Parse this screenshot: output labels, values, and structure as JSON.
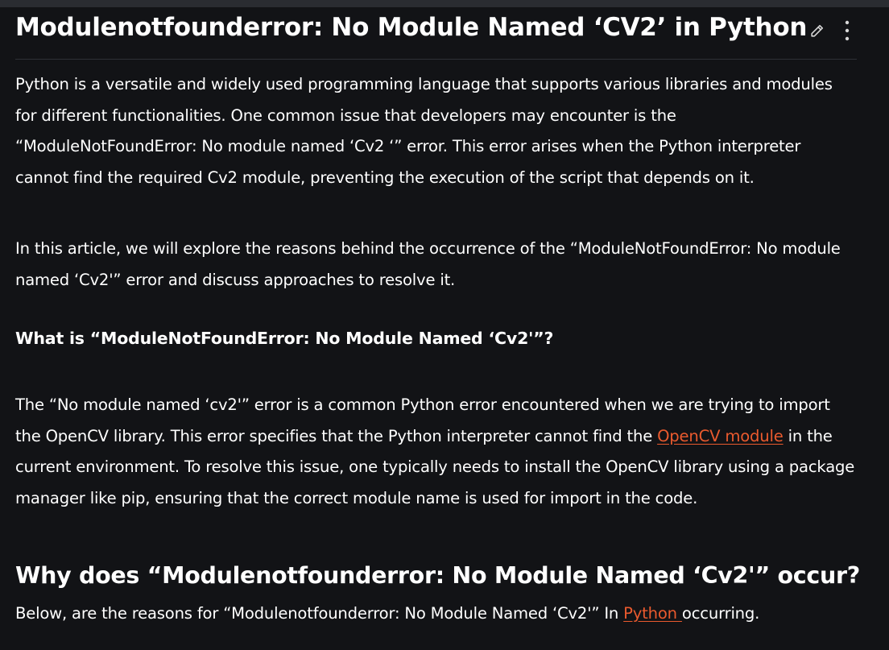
{
  "article": {
    "title": "Modulenotfounderror: No Module Named ‘CV2’ in Python",
    "actions": {
      "edit_icon": "pencil-icon",
      "more_icon": "more-vertical-icon"
    },
    "p1": "Python is a versatile and widely used programming language that supports various libraries and modules for different functionalities. One common issue that developers may encounter is the “ModuleNotFoundError: No module named ‘Cv2 ‘” error. This error arises when the Python interpreter cannot find the required Cv2 module, preventing the execution of the script that depends on it.",
    "p2": "In this article, we will explore the reasons behind the occurrence of the “ModuleNotFoundError: No module named ‘Cv2'” error and discuss approaches to resolve it.",
    "h3": "What is “ModuleNotFoundError: No Module Named ‘Cv2'”?",
    "p3": {
      "before": "The “No module named ‘cv2'” error is a common Python error encountered when we are trying to import the OpenCV library. This error specifies that the Python interpreter cannot find the ",
      "link": "OpenCV module",
      "after": " in the current environment. To resolve this issue, one typically needs to install the OpenCV library using a package manager like pip, ensuring that the correct module name is used for import in the code."
    },
    "h2": "Why does “Modulenotfounderror: No Module Named ‘Cv2'” occur?",
    "p4": {
      "before": "Below, are the reasons for “Modulenotfounderror: No Module Named ‘Cv2'” In ",
      "link": "Python ",
      "after": "occurring."
    },
    "colors": {
      "background": "#121316",
      "text": "#ffffff",
      "link": "#ea5a2e"
    }
  }
}
